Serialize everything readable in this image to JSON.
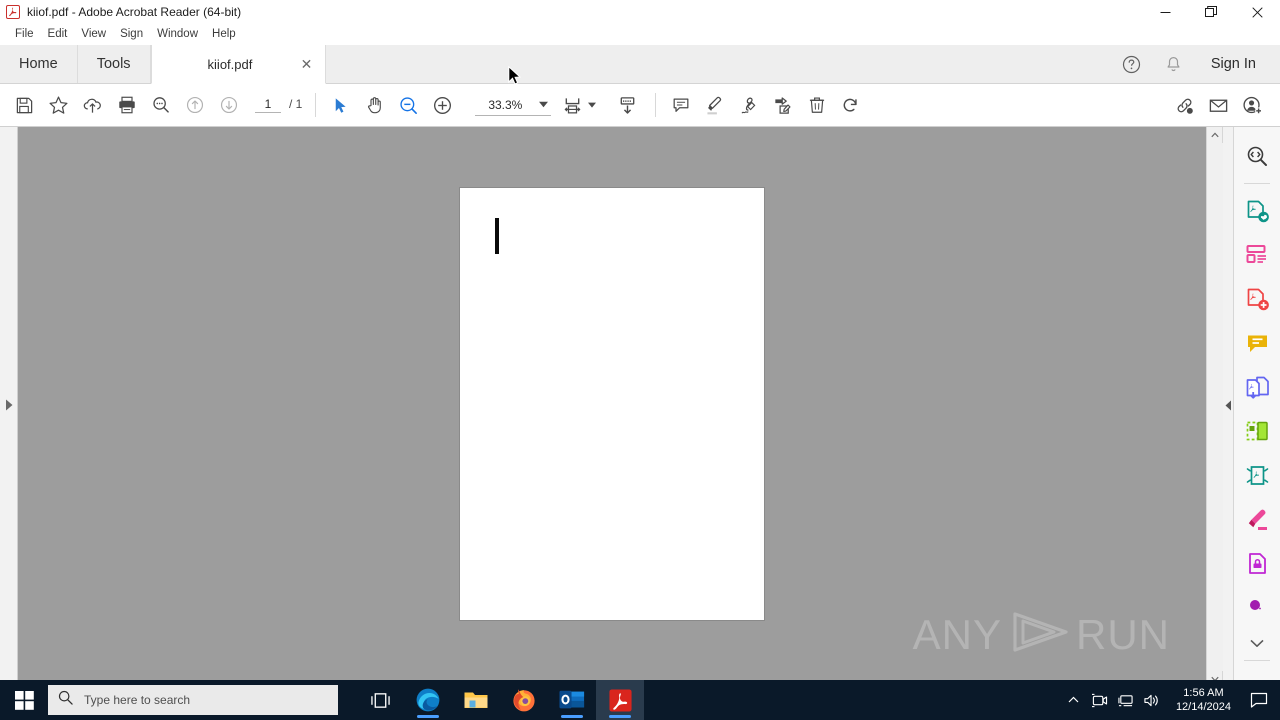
{
  "window": {
    "title": "kiiof.pdf - Adobe Acrobat Reader (64-bit)",
    "app_icon": "acrobat-icon",
    "controls": {
      "minimize": "—",
      "maximize": "❐",
      "close": "✕"
    }
  },
  "menubar": {
    "items": [
      {
        "label": "File"
      },
      {
        "label": "Edit"
      },
      {
        "label": "View"
      },
      {
        "label": "Sign"
      },
      {
        "label": "Window"
      },
      {
        "label": "Help"
      }
    ]
  },
  "tabstrip": {
    "home_label": "Home",
    "tools_label": "Tools",
    "document_tab": {
      "label": "kiiof.pdf",
      "close": "✕"
    },
    "help_icon": "help-circle-icon",
    "bell_icon": "bell-icon",
    "signin_label": "Sign In"
  },
  "toolbar": {
    "save_icon": "save-floppy-icon",
    "star_icon": "star-icon",
    "upload_icon": "cloud-upload-icon",
    "print_icon": "print-icon",
    "find_icon": "find-search-icon",
    "prev_page_icon": "arrow-up-circle-icon",
    "next_page_icon": "arrow-down-circle-icon",
    "page_current": "1",
    "page_total": "/ 1",
    "select_icon": "select-cursor-icon",
    "hand_icon": "hand-pan-icon",
    "zoom_out_icon": "zoom-out-icon",
    "zoom_in_icon": "zoom-in-icon",
    "zoom_value": "33.3%",
    "zoom_caret_icon": "chevron-down-icon",
    "fit_icon": "fit-page-width-icon",
    "fit_caret_icon": "chevron-down-icon",
    "scroll_mode_icon": "page-scroll-down-icon",
    "comment_icon": "comment-bubble-icon",
    "highlight_icon": "highlighter-pen-icon",
    "draw_icon": "freehand-draw-icon",
    "fill_sign_icon": "fill-and-sign-icon",
    "delete_icon": "trash-delete-icon",
    "rotate_icon": "rotate-clockwise-icon",
    "share_link_icon": "share-link-icon",
    "email_icon": "email-envelope-icon",
    "add_user_icon": "add-person-icon"
  },
  "right_rail": {
    "items": [
      {
        "icon": "search-document-icon",
        "label": "Search document"
      },
      {
        "icon": "export-pdf-icon",
        "label": "Export PDF"
      },
      {
        "icon": "create-pdf-icon",
        "label": "Create PDF"
      },
      {
        "icon": "edit-pdf-icon",
        "label": "Edit PDF"
      },
      {
        "icon": "comment-icon",
        "label": "Comment"
      },
      {
        "icon": "combine-files-icon",
        "label": "Combine Files"
      },
      {
        "icon": "organize-pages-icon",
        "label": "Organize Pages"
      },
      {
        "icon": "compress-pdf-icon",
        "label": "Compress PDF"
      },
      {
        "icon": "redact-icon",
        "label": "Redact"
      },
      {
        "icon": "protect-icon",
        "label": "Protect"
      },
      {
        "icon": "more-tools-icon",
        "label": "More Tools"
      }
    ],
    "chevron_icon": "chevron-down-icon",
    "collapse_icon": "collapse-panel-icon"
  },
  "document": {
    "page_count": 1,
    "caret_visible": true,
    "watermark": {
      "left_text": "ANY",
      "right_text": "RUN",
      "logo": "anyrun-play-icon"
    }
  },
  "scrollbar": {
    "up_icon": "scroll-up-arrow-icon",
    "down_icon": "scroll-down-arrow-icon",
    "collapse_icon": "collapse-left-arrow-icon",
    "expand_icon": "expand-right-arrow-icon"
  },
  "taskbar": {
    "start_icon": "windows-start-icon",
    "search": {
      "placeholder": "Type here to search",
      "icon": "search-icon"
    },
    "task_view_icon": "task-view-icon",
    "apps": [
      {
        "icon": "edge-icon",
        "label": "Microsoft Edge",
        "running": true
      },
      {
        "icon": "file-explorer-icon",
        "label": "File Explorer",
        "running": false
      },
      {
        "icon": "firefox-icon",
        "label": "Mozilla Firefox",
        "running": false
      },
      {
        "icon": "outlook-icon",
        "label": "Outlook",
        "running": true
      },
      {
        "icon": "acrobat-icon",
        "label": "Adobe Acrobat Reader",
        "running": true,
        "active": true
      }
    ],
    "tray": {
      "chevron_icon": "show-hidden-icons-icon",
      "camera_icon": "camera-record-icon",
      "network_icon": "network-icon",
      "volume_icon": "volume-icon",
      "time": "1:56 AM",
      "date": "12/14/2024",
      "action_center_icon": "action-center-icon"
    }
  },
  "colors": {
    "accent": "#1473e6",
    "acrobat_red": "#d9251d",
    "taskbar": "#0a1929",
    "canvas_gray": "#9d9d9d"
  }
}
